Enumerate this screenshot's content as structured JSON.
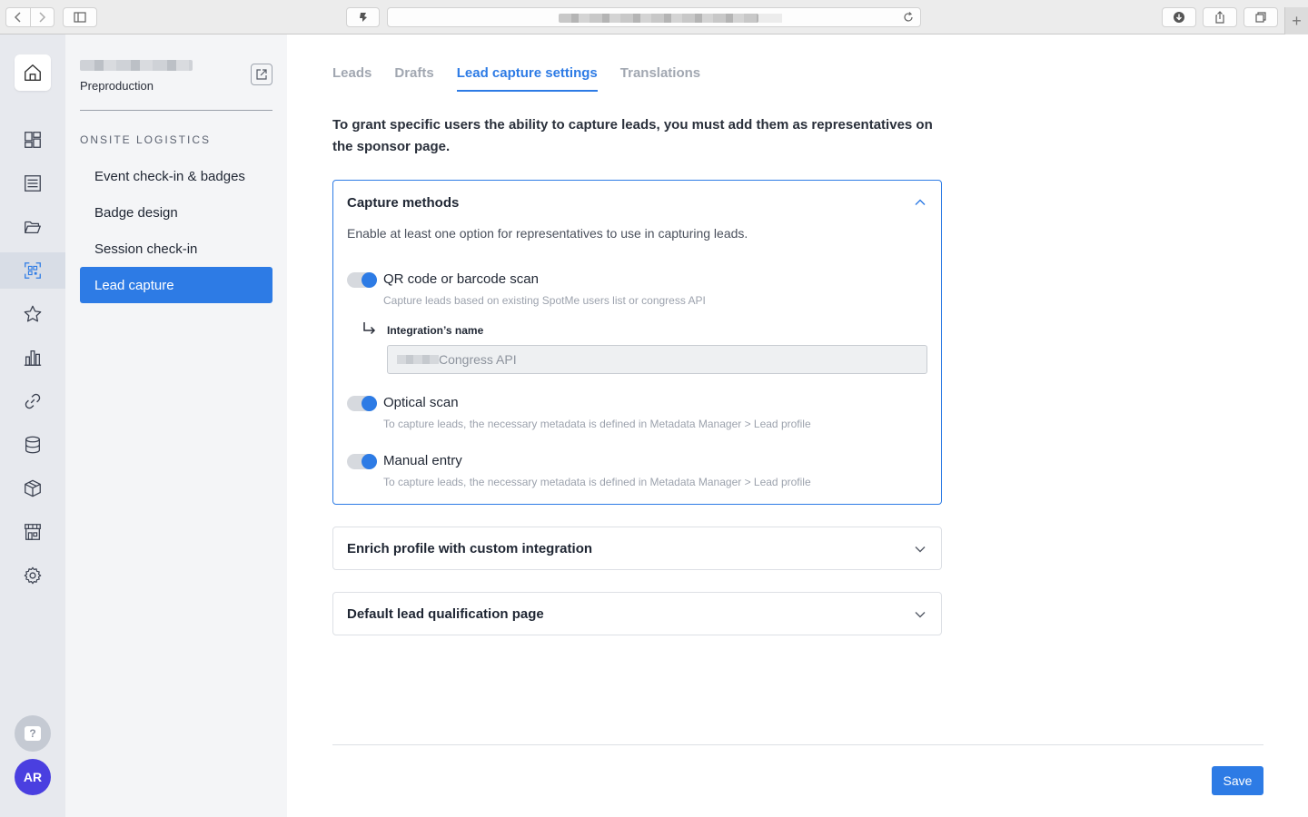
{
  "browser": {
    "back_icon": "chevron-left-icon",
    "forward_icon": "chevron-right-icon",
    "sidebar_icon": "sidebar-icon",
    "extension_icon": "extension-icon",
    "reload_icon": "reload-icon",
    "download_icon": "download-icon",
    "share_icon": "share-icon",
    "tabs_icon": "tabs-icon",
    "new_tab_label": "+"
  },
  "rail": {
    "items": [
      {
        "name": "home",
        "icon": "home-icon"
      },
      {
        "name": "dashboard",
        "icon": "dashboard-icon"
      },
      {
        "name": "content",
        "icon": "list-icon"
      },
      {
        "name": "library",
        "icon": "folder-icon"
      },
      {
        "name": "onsite-logistics",
        "icon": "qr-scan-icon",
        "active": true
      },
      {
        "name": "engagement",
        "icon": "star-icon"
      },
      {
        "name": "analytics",
        "icon": "bar-chart-icon"
      },
      {
        "name": "integrations",
        "icon": "link-icon"
      },
      {
        "name": "data",
        "icon": "database-icon"
      },
      {
        "name": "packages",
        "icon": "box-icon"
      },
      {
        "name": "marketplace",
        "icon": "store-icon"
      },
      {
        "name": "settings",
        "icon": "gear-icon"
      }
    ],
    "help_label": "?",
    "avatar_initials": "AR",
    "accent": "#2d7be5",
    "avatar_color": "#4a3fe0"
  },
  "sidebar": {
    "project_subtitle": "Preproduction",
    "section_heading": "ONSITE LOGISTICS",
    "items": [
      {
        "label": "Event check-in & badges",
        "active": false
      },
      {
        "label": "Badge design",
        "active": false
      },
      {
        "label": "Session check-in",
        "active": false
      },
      {
        "label": "Lead capture",
        "active": true
      }
    ]
  },
  "main": {
    "tabs": [
      {
        "label": "Leads",
        "active": false
      },
      {
        "label": "Drafts",
        "active": false
      },
      {
        "label": "Lead capture settings",
        "active": true
      },
      {
        "label": "Translations",
        "active": false
      }
    ],
    "intro": "To grant specific users the ability to capture leads, you must add them as representatives on the sponsor page.",
    "capture_methods": {
      "title": "Capture methods",
      "description": "Enable at least one option for representatives to use in capturing leads.",
      "options": [
        {
          "label": "QR code or barcode scan",
          "hint": "Capture leads based on existing SpotMe users list or congress API",
          "enabled": true
        },
        {
          "label": "Optical scan",
          "hint": "To capture leads, the necessary metadata is defined in Metadata Manager > Lead profile",
          "enabled": true
        },
        {
          "label": "Manual entry",
          "hint": "To capture leads, the necessary metadata is defined in Metadata Manager > Lead profile",
          "enabled": true
        }
      ],
      "integration_label": "Integration’s name",
      "integration_value": "Congress API"
    },
    "enrich_panel": {
      "title": "Enrich profile with custom integration"
    },
    "qualification_panel": {
      "title": "Default lead qualification page"
    },
    "save_label": "Save"
  }
}
